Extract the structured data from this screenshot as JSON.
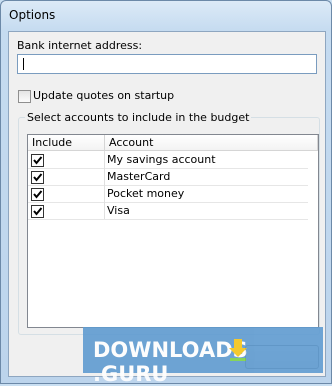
{
  "window": {
    "title": "Options"
  },
  "bank": {
    "label": "Bank internet address:",
    "value": ""
  },
  "update_quotes": {
    "label": "Update quotes on startup",
    "checked": false
  },
  "accounts_group": {
    "title": "Select accounts to include in the budget",
    "columns": [
      "Include",
      "Account"
    ],
    "rows": [
      {
        "include": true,
        "account": "My savings account"
      },
      {
        "include": true,
        "account": "MasterCard"
      },
      {
        "include": true,
        "account": "Pocket money"
      },
      {
        "include": true,
        "account": "Visa"
      }
    ]
  },
  "watermark": {
    "text_left": "DOWNLOADS",
    "text_right": ".GURU",
    "colors": {
      "bg": "#5f9bd0",
      "logo": "#f5c518"
    }
  }
}
